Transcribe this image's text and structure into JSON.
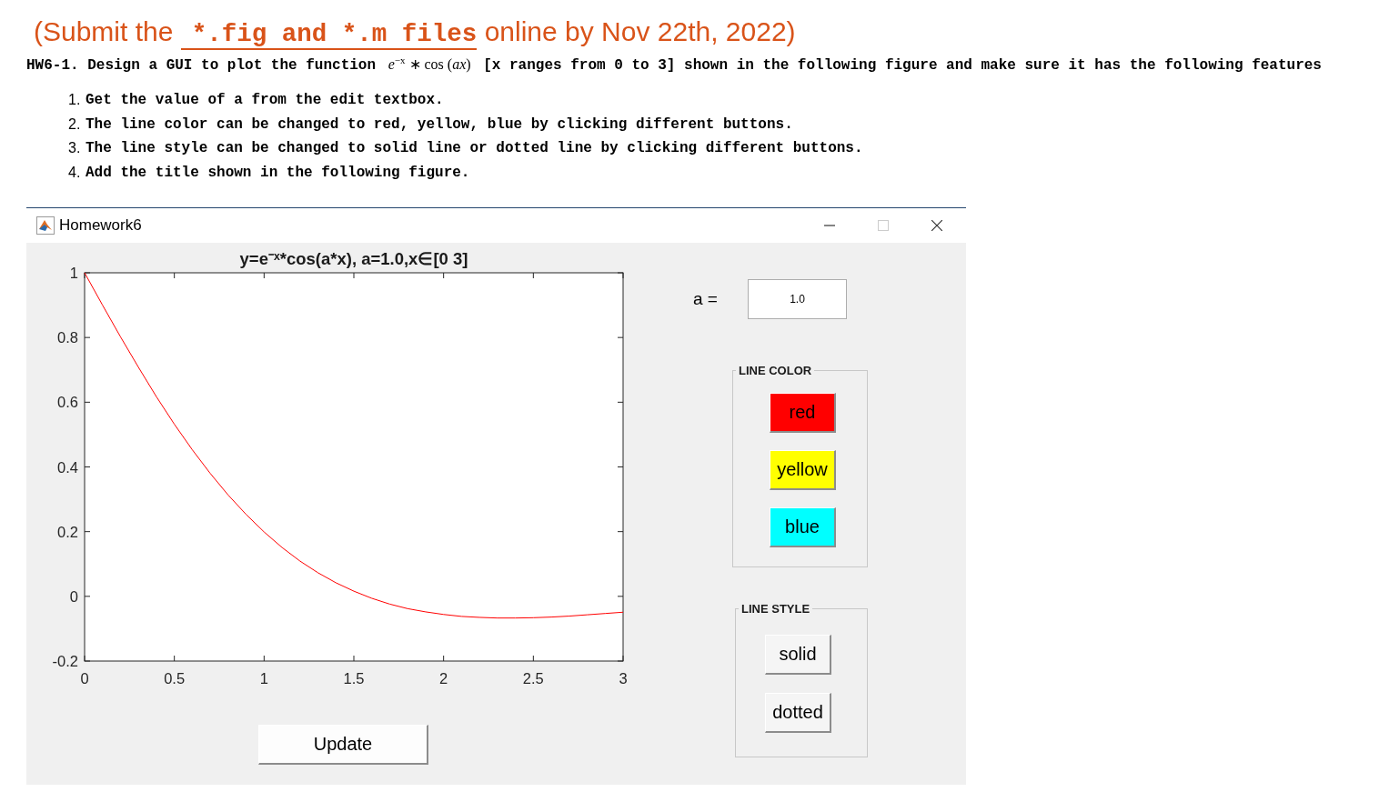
{
  "submission_note": {
    "lead": "(Submit the",
    "files": "*.fig and *.m files",
    "tail": "online by Nov 22th, 2022)"
  },
  "task": {
    "lead": "HW6-1. Design a GUI to plot the function",
    "formula": "*e*$^{−x}$ ∗ cos (*ax*)",
    "tail": "[x ranges from 0 to 3] shown in the following figure and make sure it has the following features"
  },
  "requirements": [
    {
      "number": "1.",
      "text": "Get the value of a from the edit textbox."
    },
    {
      "number": "2.",
      "text": "The line color can be changed to red, yellow, blue by clicking different buttons."
    },
    {
      "number": "3.",
      "text": "The line style can be changed to solid line or dotted line by clicking different buttons."
    },
    {
      "number": "4.",
      "text": "Add the title shown in the following figure."
    }
  ],
  "window": {
    "title": "Homework6",
    "controls": [
      {
        "kind": "minimize",
        "disabled": false
      },
      {
        "kind": "maximize",
        "disabled": true
      },
      {
        "kind": "close",
        "disabled": false
      }
    ]
  },
  "plot": {
    "chart_data": {
      "type": "line",
      "title": "y=e⁻ˣ*cos(a*x), a=1.0,x∈[0 3]",
      "x": [
        0,
        0.1,
        0.2,
        0.3,
        0.4,
        0.5,
        0.6,
        0.7,
        0.8,
        0.9,
        1,
        1.1,
        1.2,
        1.3,
        1.4,
        1.5,
        1.6,
        1.7,
        1.8,
        1.9,
        2,
        2.1,
        2.2,
        2.3,
        2.4,
        2.5,
        2.6,
        2.7,
        2.8,
        2.9,
        3
      ],
      "series": [
        {
          "color": "#ff0000",
          "values": [
            1,
            0.9,
            0.802,
            0.708,
            0.617,
            0.532,
            0.453,
            0.38,
            0.313,
            0.253,
            0.199,
            0.151,
            0.109,
            0.073,
            0.042,
            0.016,
            -0.006,
            -0.024,
            -0.038,
            -0.048,
            -0.056,
            -0.062,
            -0.065,
            -0.067,
            -0.067,
            -0.066,
            -0.064,
            -0.061,
            -0.057,
            -0.053,
            -0.049
          ]
        }
      ],
      "xlim": [
        0,
        3
      ],
      "ylim": [
        -0.2,
        1
      ],
      "xticks": [
        0,
        0.5,
        1,
        1.5,
        2,
        2.5,
        3
      ],
      "yticks": [
        -0.2,
        0,
        0.2,
        0.4,
        0.6,
        0.8,
        1
      ]
    }
  },
  "update_button": {
    "label": "Update"
  },
  "a_field": {
    "label": "a =",
    "value": "1.0"
  },
  "line_color": {
    "title": "LINE COLOR",
    "buttons": [
      {
        "label": "red",
        "color": "#ff0000"
      },
      {
        "label": "yellow",
        "color": "#ffff00"
      },
      {
        "label": "blue",
        "color": "#00ffff"
      }
    ]
  },
  "line_style": {
    "title": "LINE STYLE",
    "buttons": [
      {
        "label": "solid"
      },
      {
        "label": "dotted"
      }
    ]
  }
}
